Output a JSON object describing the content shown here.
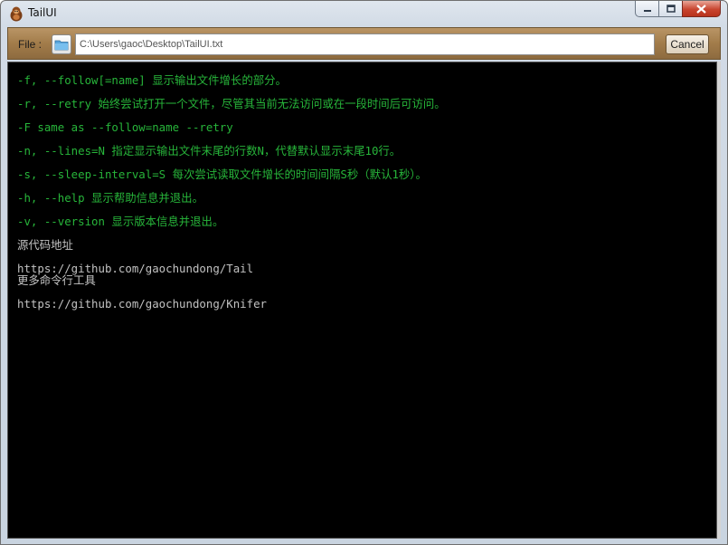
{
  "window": {
    "title": "TailUI",
    "icons": {
      "app": "gorilla-app-icon",
      "minimize": "minimize-icon",
      "maximize": "maximize-icon",
      "close": "close-icon",
      "folder": "folder-icon"
    },
    "colors": {
      "console_bg": "#000000",
      "option_text": "#27b53a",
      "plain_text": "#c2c2c2",
      "toolbar": "#a27c4a",
      "close": "#c8452f"
    }
  },
  "toolbar": {
    "file_label": "File :",
    "path_value": "C:\\Users\\gaoc\\Desktop\\TailUI.txt",
    "cancel_label": "Cancel"
  },
  "console": {
    "lines": [
      "-f, --follow[=name] 显示输出文件增长的部分。",
      "-r, --retry 始终尝试打开一个文件，尽管其当前无法访问或在一段时间后可访问。",
      "-F same as --follow=name --retry",
      "-n, --lines=N 指定显示输出文件末尾的行数N，代替默认显示末尾10行。",
      "-s, --sleep-interval=S 每次尝试读取文件增长的时间间隔S秒（默认1秒）。",
      "-h, --help 显示帮助信息并退出。",
      "-v, --version 显示版本信息并退出。",
      "源代码地址",
      "https://github.com/gaochundong/Tail",
      "更多命令行工具",
      "https://github.com/gaochundong/Knifer"
    ]
  }
}
